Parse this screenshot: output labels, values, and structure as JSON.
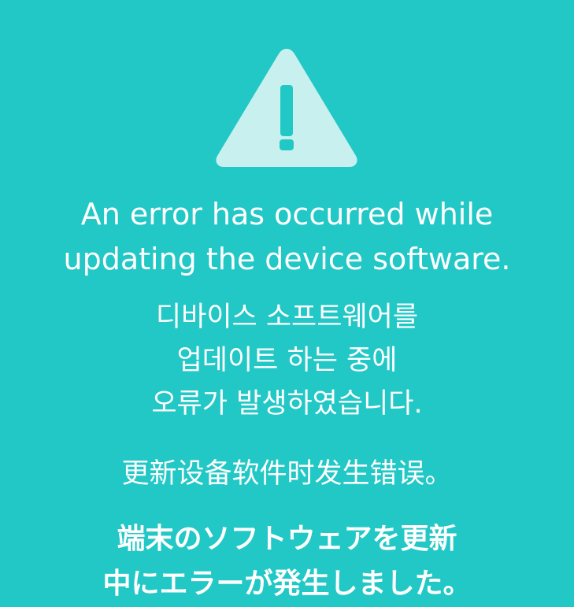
{
  "screen": {
    "background_color": "#22c8c6",
    "icon": {
      "name": "warning-icon",
      "fill_color": "#c8f0ee",
      "mark_color": "#22c8c6"
    },
    "messages": {
      "english": {
        "line1": "An error has occurred while",
        "line2": "updating the device software."
      },
      "korean": {
        "line1": "디바이스 소프트웨어를",
        "line2": "업데이트 하는 중에",
        "line3": "오류가 발생하였습니다."
      },
      "chinese": {
        "line1": "更新设备软件时发生错误。"
      },
      "japanese": {
        "line1": "端末のソフトウェアを更新",
        "line2": "中にエラーが発生しました。"
      }
    }
  }
}
